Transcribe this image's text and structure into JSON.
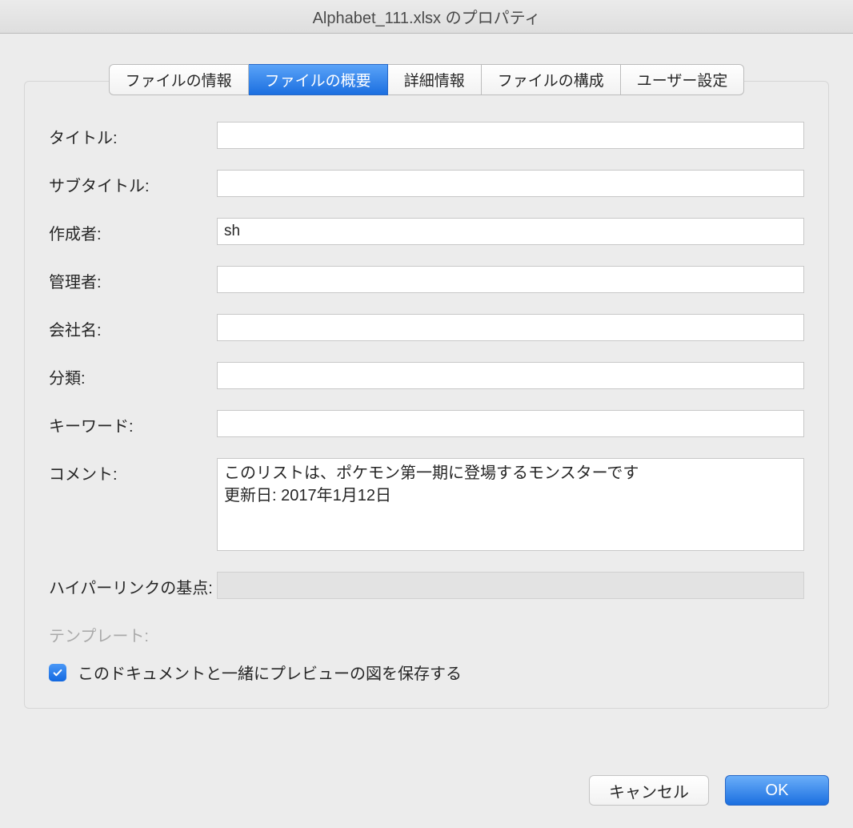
{
  "window": {
    "title": "Alphabet_111.xlsx のプロパティ"
  },
  "tabs": [
    {
      "label": "ファイルの情報"
    },
    {
      "label": "ファイルの概要"
    },
    {
      "label": "詳細情報"
    },
    {
      "label": "ファイルの構成"
    },
    {
      "label": "ユーザー設定"
    }
  ],
  "form": {
    "title_label": "タイトル:",
    "title_value": "",
    "subtitle_label": "サブタイトル:",
    "subtitle_value": "",
    "author_label": "作成者:",
    "author_value": "sh",
    "manager_label": "管理者:",
    "manager_value": "",
    "company_label": "会社名:",
    "company_value": "",
    "category_label": "分類:",
    "category_value": "",
    "keyword_label": "キーワード:",
    "keyword_value": "",
    "comment_label": "コメント:",
    "comment_value": "このリストは、ポケモン第一期に登場するモンスターです\n更新日: 2017年1月12日",
    "hyperlink_label": "ハイパーリンクの基点:",
    "hyperlink_value": "",
    "template_label": "テンプレート:",
    "preview_checkbox_label": "このドキュメントと一緒にプレビューの図を保存する",
    "preview_checked": true
  },
  "buttons": {
    "cancel": "キャンセル",
    "ok": "OK"
  }
}
